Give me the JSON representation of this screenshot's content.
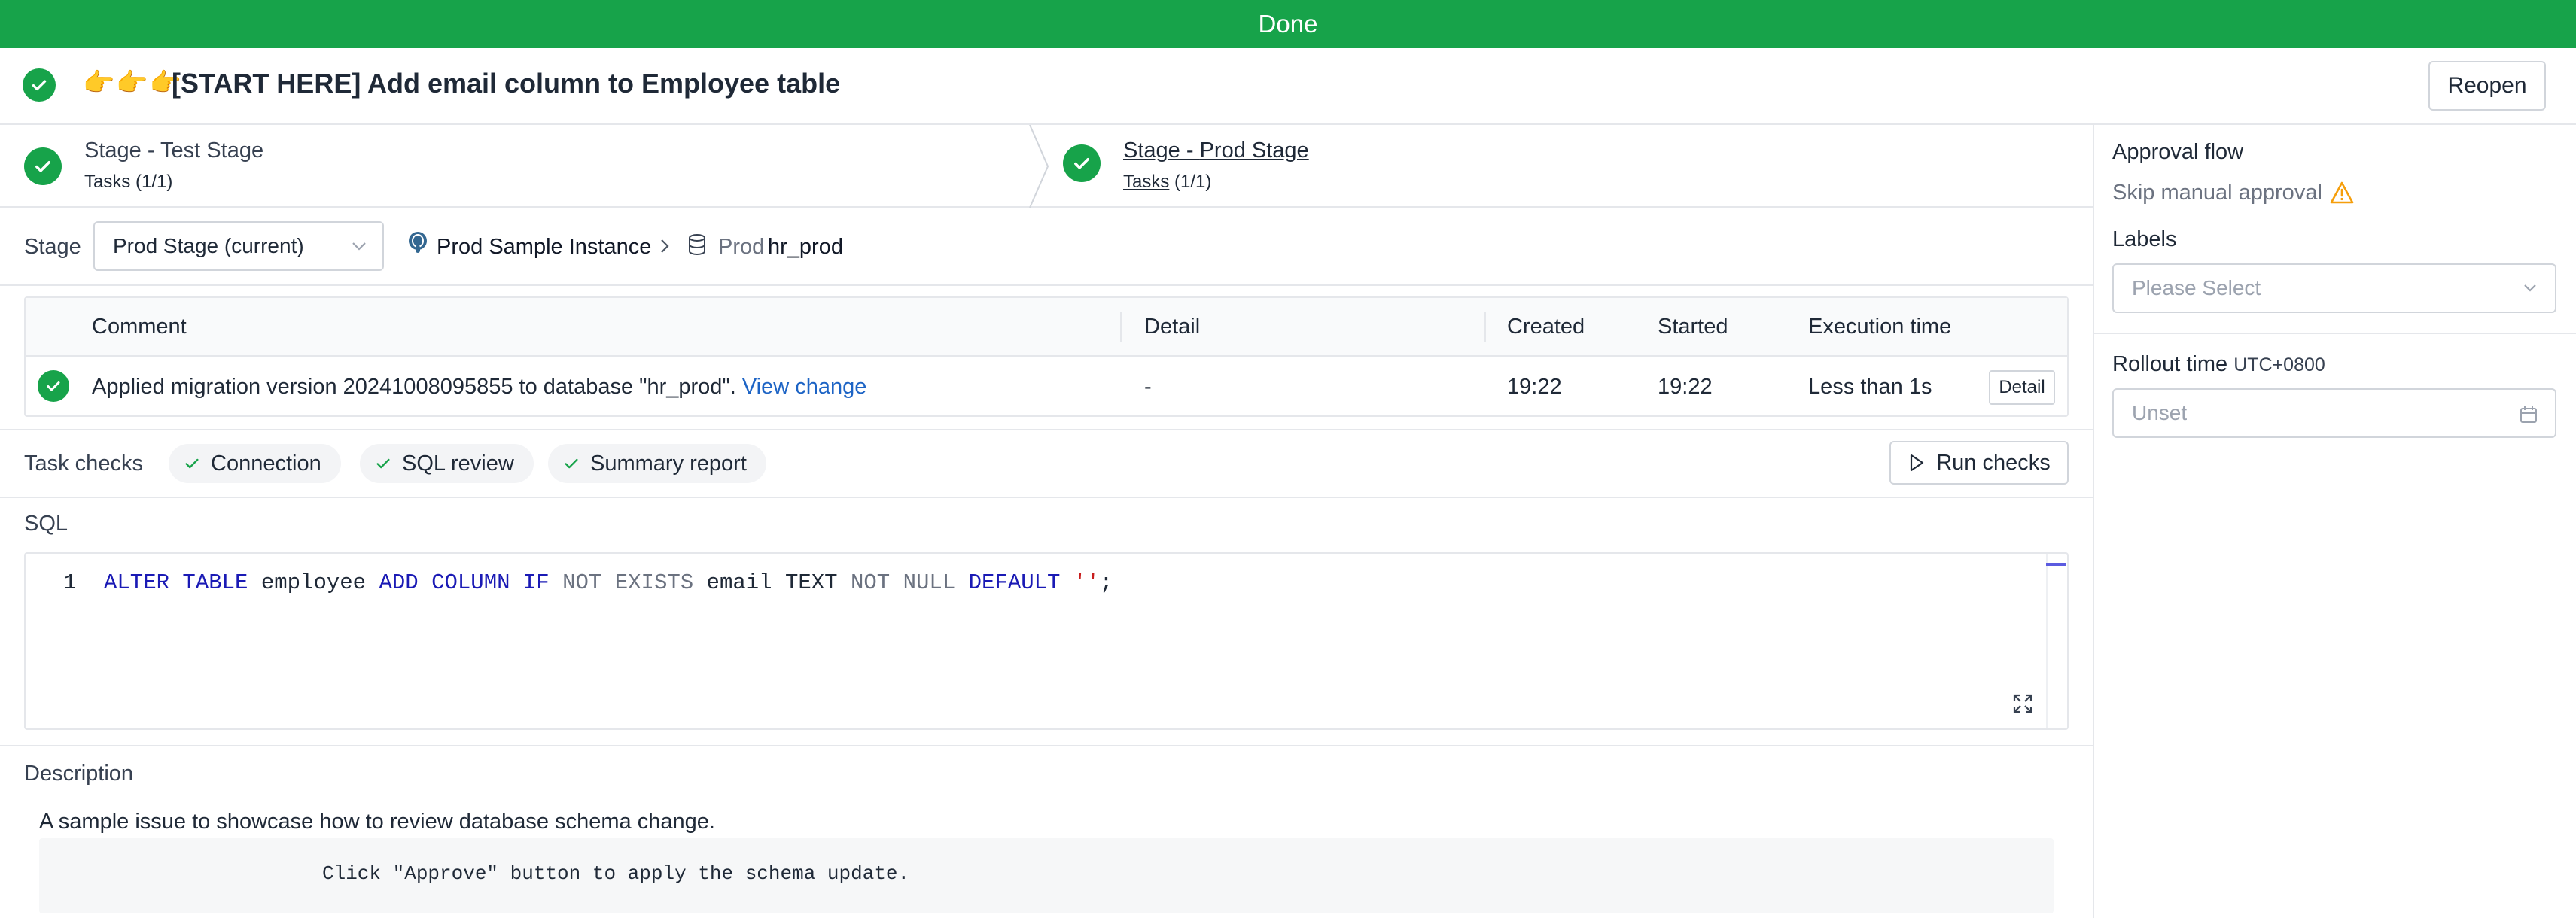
{
  "banner": {
    "status": "Done"
  },
  "header": {
    "emoji": "👉👉👉",
    "title": "[START HERE] Add email column to Employee table",
    "reopen_label": "Reopen"
  },
  "stages": [
    {
      "prefix": "Stage",
      "separator": " - ",
      "name": "Test Stage",
      "tasks_label": "Tasks",
      "tasks_count": "(1/1)"
    },
    {
      "prefix": "Stage",
      "separator": " - ",
      "name": "Prod Stage",
      "tasks_label": "Tasks",
      "tasks_count": "(1/1)"
    }
  ],
  "stage_select": {
    "label": "Stage",
    "value": "Prod Stage (current)",
    "instance": "Prod Sample Instance",
    "db_env": "Prod",
    "db_name": "hr_prod"
  },
  "task_table": {
    "columns": [
      "Comment",
      "Detail",
      "Created",
      "Started",
      "Execution time"
    ],
    "row": {
      "comment": "Applied migration version 20241008095855 to database \"hr_prod\".",
      "link": "View change",
      "detail": "-",
      "created": "19:22",
      "started": "19:22",
      "execution_time": "Less than 1s",
      "detail_button": "Detail"
    }
  },
  "task_checks": {
    "label": "Task checks",
    "items": [
      "Connection",
      "SQL review",
      "Summary report"
    ],
    "run_label": "Run checks"
  },
  "sql": {
    "label": "SQL",
    "line_number": "1",
    "tokens": {
      "t1": "ALTER TABLE",
      "t2": " employee ",
      "t3": "ADD COLUMN IF",
      "t4": " NOT EXISTS",
      "t5": " email TEXT ",
      "t6": "NOT NULL",
      "t7": " ",
      "t8": "DEFAULT",
      "t9": " ",
      "t10": "''",
      "t11": ";"
    }
  },
  "description": {
    "label": "Description",
    "text": "A sample issue to showcase how to review database schema change.",
    "code": "Click \"Approve\" button to apply the schema update."
  },
  "sidebar": {
    "approval_title": "Approval flow",
    "approval_value": "Skip manual approval",
    "labels_title": "Labels",
    "labels_placeholder": "Please Select",
    "rollout_title": "Rollout time",
    "rollout_tz": "UTC+0800",
    "rollout_placeholder": "Unset"
  },
  "colors": {
    "success": "#17a34a",
    "link": "#1d64c5",
    "warning": "#f59e0b"
  }
}
